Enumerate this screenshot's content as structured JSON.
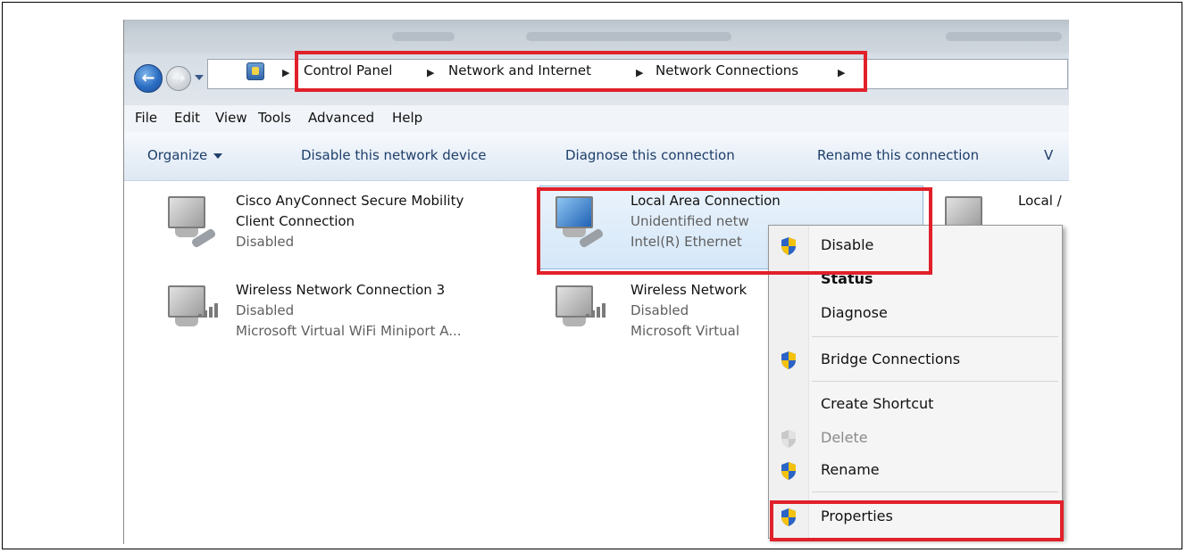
{
  "address": {
    "crumbs": [
      "Control Panel",
      "Network and Internet",
      "Network Connections"
    ]
  },
  "menubar": [
    "File",
    "Edit",
    "View",
    "Tools",
    "Advanced",
    "Help"
  ],
  "commandbar": {
    "organize": "Organize",
    "items": [
      "Disable this network device",
      "Diagnose this connection",
      "Rename this connection",
      "V"
    ]
  },
  "connections": [
    {
      "lines": [
        "Cisco AnyConnect Secure Mobility",
        "Client Connection",
        "Disabled"
      ]
    },
    {
      "lines": [
        "Local Area Connection",
        "Unidentified netw",
        "Intel(R) Ethernet"
      ]
    },
    {
      "lines": [
        "Local /"
      ]
    },
    {
      "lines": [
        "Wireless Network Connection 3",
        "Disabled",
        "Microsoft Virtual WiFi Miniport A..."
      ]
    },
    {
      "lines": [
        "Wireless Network",
        "Disabled",
        "Microsoft Virtual"
      ]
    }
  ],
  "context_menu": [
    {
      "label": "Disable",
      "icon": "uac-shield-icon"
    },
    {
      "label": "Status"
    },
    {
      "label": "Diagnose"
    },
    {
      "label": "Bridge Connections",
      "icon": "uac-shield-icon"
    },
    {
      "label": "Create Shortcut"
    },
    {
      "label": "Delete",
      "icon": "uac-shield-icon-disabled"
    },
    {
      "label": "Rename",
      "icon": "uac-shield-icon"
    },
    {
      "label": "Properties",
      "icon": "uac-shield-icon"
    }
  ],
  "colors": {
    "annotation": "#e0202a",
    "highlight": "#d5e7f8",
    "command_text": "#1e3e6a"
  }
}
